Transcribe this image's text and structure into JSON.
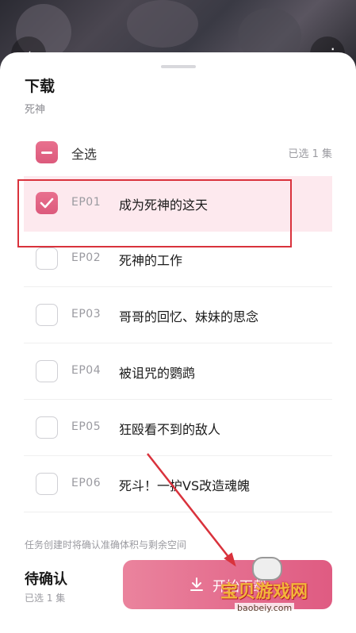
{
  "sheet": {
    "title": "下载",
    "subtitle": "死神",
    "select_all": {
      "label": "全选",
      "selected_count": "已选 1 集",
      "state": "partial"
    },
    "episodes": [
      {
        "ep": "EP01",
        "title": "成为死神的这天",
        "checked": true
      },
      {
        "ep": "EP02",
        "title": "死神的工作",
        "checked": false
      },
      {
        "ep": "EP03",
        "title": "哥哥的回忆、妹妹的思念",
        "checked": false
      },
      {
        "ep": "EP04",
        "title": "被诅咒的鹦鹉",
        "checked": false
      },
      {
        "ep": "EP05",
        "title": "狂殴看不到的敌人",
        "checked": false
      },
      {
        "ep": "EP06",
        "title": "死斗！一护VS改造魂魄",
        "checked": false
      }
    ],
    "hint": "任务创建时将确认准确体积与剩余空间",
    "footer": {
      "pending": "待确认",
      "pending_count": "已选 1 集",
      "download_label": "开始下载"
    }
  },
  "watermark": {
    "text": "宝贝游戏网",
    "url": "baobeiy.com"
  },
  "colors": {
    "accent": "#df5b82",
    "highlight_box": "#d9323c",
    "selected_row": "#fde9ee"
  },
  "icons": {
    "back": "back-arrow-icon",
    "share": "share-icon",
    "download": "download-icon",
    "check": "checkmark-icon"
  }
}
